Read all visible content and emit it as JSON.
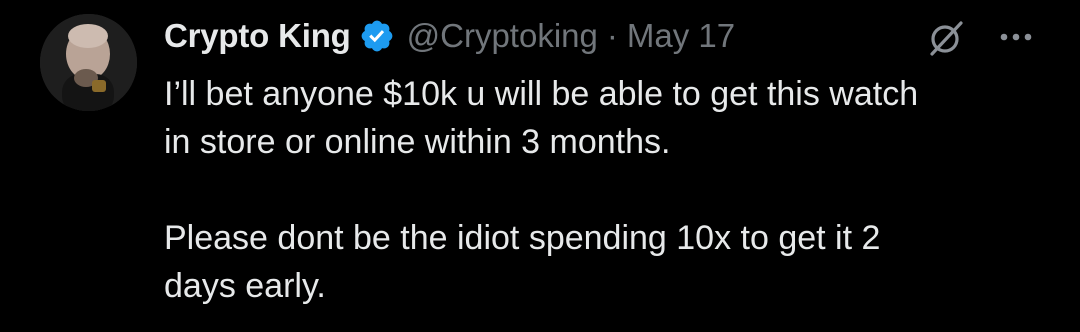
{
  "author": {
    "display_name": "Crypto King",
    "handle": "@Cryptoking",
    "separator": "·",
    "date": "May 17",
    "verified_color": "#1d9bf0"
  },
  "tweet": {
    "paragraph_1_line_1": "I’ll bet anyone $10k u will be able to get this watch",
    "paragraph_1_line_2": "in store or online within 3 months.",
    "paragraph_2_line_1": "Please dont be the idiot spending 10x to get it 2",
    "paragraph_2_line_2": "days early."
  },
  "icons": {
    "avatar": "avatar-image",
    "verified": "verified-badge-icon",
    "grok": "grok-icon",
    "more": "more-options-icon"
  },
  "colors": {
    "background": "#000000",
    "primary_text": "#e7e9ea",
    "secondary_text": "#71767b"
  }
}
